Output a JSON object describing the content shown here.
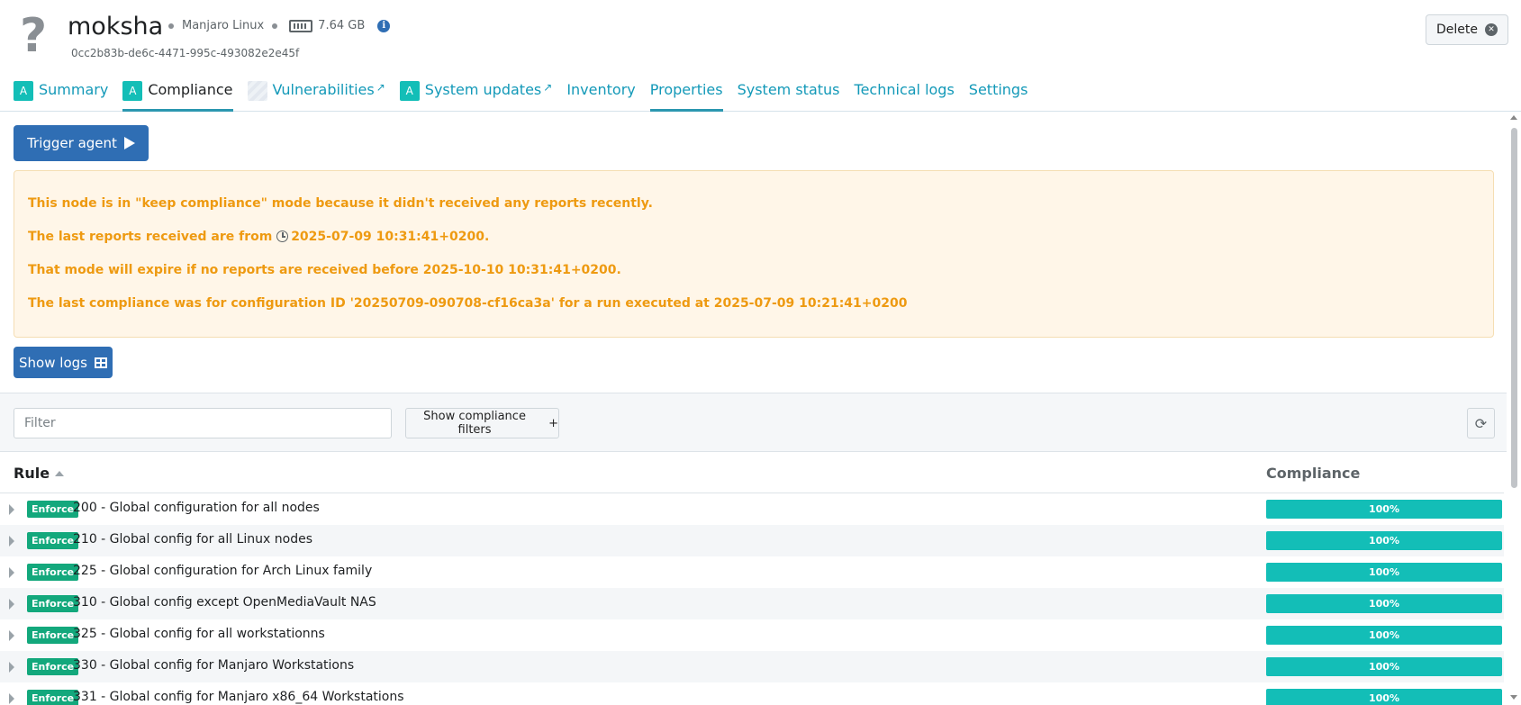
{
  "node": {
    "icon": "question-mark-icon",
    "name": "moksha",
    "os": "Manjaro Linux",
    "ram": "7.64 GB",
    "uuid": "0cc2b83b-de6c-4471-995c-493082e2e45f",
    "delete_label": "Delete"
  },
  "tabs": [
    {
      "badge": "A",
      "label": "Summary"
    },
    {
      "badge": "A",
      "label": "Compliance"
    },
    {
      "badge": "",
      "label": "Vulnerabilities"
    },
    {
      "badge": "A",
      "label": "System updates"
    },
    {
      "label": "Inventory"
    },
    {
      "label": "Properties"
    },
    {
      "label": "System status"
    },
    {
      "label": "Technical logs"
    },
    {
      "label": "Settings"
    }
  ],
  "actions": {
    "trigger_agent": "Trigger agent",
    "show_logs": "Show logs"
  },
  "warning": {
    "line1": "This node is in \"keep compliance\" mode because it didn't received any reports recently.",
    "line2_prefix": "The last reports received are from",
    "line2_date": "2025-07-09 10:31:41+0200",
    "line2_suffix": ".",
    "line3": "That mode will expire if no reports are received before 2025-10-10 10:31:41+0200.",
    "line4": "The last compliance was for configuration ID '20250709-090708-cf16ca3a' for a run executed at 2025-07-09 10:21:41+0200"
  },
  "filters": {
    "placeholder": "Filter",
    "value": "",
    "show_filters_label": "Show compliance filters",
    "plus": "+"
  },
  "table": {
    "col_rule": "Rule",
    "col_compliance": "Compliance",
    "rows": [
      {
        "mode": "Enforce",
        "name": "200 - Global configuration for all nodes",
        "compliance": "100%"
      },
      {
        "mode": "Enforce",
        "name": "210 - Global config for all Linux nodes",
        "compliance": "100%"
      },
      {
        "mode": "Enforce",
        "name": "225 - Global configuration for Arch Linux family",
        "compliance": "100%"
      },
      {
        "mode": "Enforce",
        "name": "310 - Global config except OpenMediaVault NAS",
        "compliance": "100%"
      },
      {
        "mode": "Enforce",
        "name": "325 - Global config for all workstationns",
        "compliance": "100%"
      },
      {
        "mode": "Enforce",
        "name": "330 - Global config for Manjaro Workstations",
        "compliance": "100%"
      },
      {
        "mode": "Enforce",
        "name": "331 - Global config for Manjaro x86_64 Workstations",
        "compliance": "100%"
      }
    ]
  },
  "colors": {
    "accent": "#1399b8",
    "primary_button": "#2f6eb4",
    "compliance_bar": "#13beb7",
    "enforce_badge": "#13a87c",
    "warning_text": "#ee9a11",
    "warning_bg": "#fff6e8"
  }
}
